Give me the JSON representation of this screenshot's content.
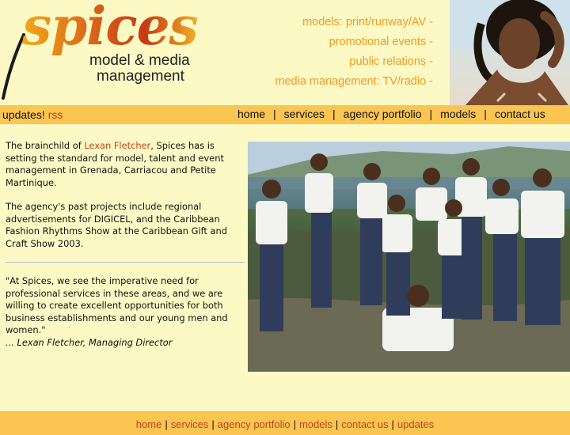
{
  "brand": {
    "logo_word": "spices",
    "subtitle_line1": "model & media",
    "subtitle_line2": "management"
  },
  "header_services": [
    "models: print/runway/AV -",
    "promotional events -",
    "public relations -",
    "media management: TV/radio -"
  ],
  "topbar": {
    "updates_label": "updates!",
    "rss_label": "rss",
    "nav": [
      "home",
      "services",
      "agency portfolio",
      "models",
      "contact us"
    ],
    "separator": "|"
  },
  "content": {
    "para1_pre": "The brainchild of ",
    "para1_link": "Lexan Fletcher",
    "para1_post": ", Spices has is setting the standard for model, talent and event management in Grenada, Carriacou and Petite Martinique.",
    "para2": "The agency's past projects include regional advertisements for DIGICEL, and the Caribbean Fashion Rhythms Show at the Caribbean Gift and Craft Show 2003.",
    "quote": "\"At Spices, we see the imperative need for professional services in these areas, and we are willing to create excellent opportunities for both business establishments and our young men and women.\"",
    "signature": "... Lexan Fletcher, Managing Director"
  },
  "footer": {
    "nav": [
      "home",
      "services",
      "agency portfolio",
      "models",
      "contact us",
      "updates"
    ],
    "separator": "|"
  },
  "colors": {
    "background": "#fdf9c5",
    "bar": "#fbc552",
    "link": "#c5421a",
    "services_text": "#f09a22"
  }
}
